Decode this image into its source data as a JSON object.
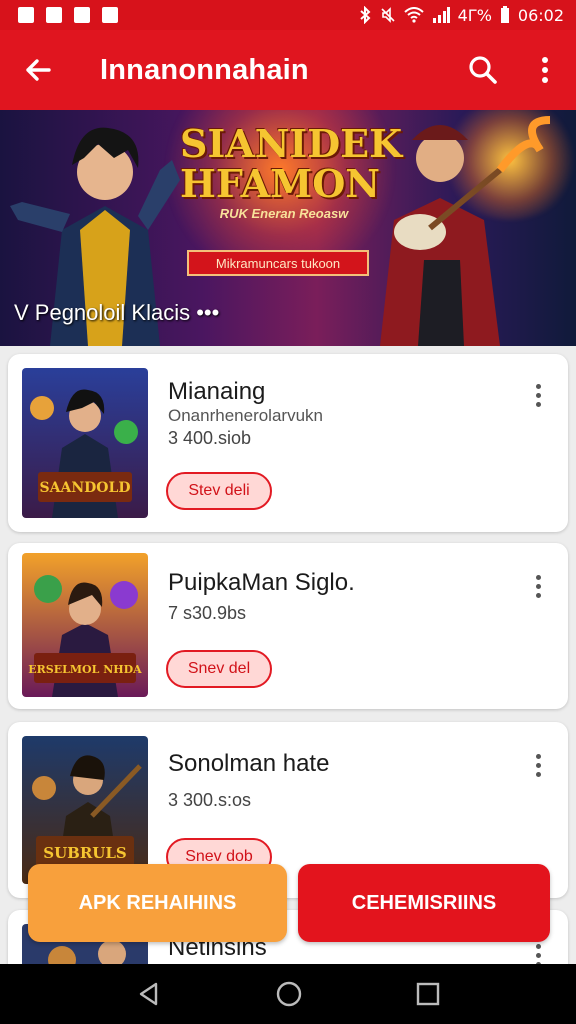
{
  "status_bar": {
    "battery": "4Γ%",
    "time": "06:02"
  },
  "app_bar": {
    "title": "Innanonnahain",
    "back_icon": "arrow-left-icon",
    "search_icon": "search-icon",
    "menu_icon": "more-vertical-icon"
  },
  "banner": {
    "title_line1": "SIANIDEK",
    "title_line2": "HFAMON",
    "subtitle": "RUK Eneran Reoasw",
    "tag": "Mikramuncars tukoon",
    "caption": "V Pegnoloil Klacis •••"
  },
  "items": [
    {
      "name": "Mianaing",
      "desc": "Onanrhenerolarvukn",
      "size": "3 400.siob",
      "button": "Stev deli",
      "thumb_label": "SAANDOLD"
    },
    {
      "name": "PuipkaMan Siglo.",
      "desc": "",
      "size": "7 s30.9bs",
      "button": "Snev del",
      "thumb_label": "ERSELMOL NHDA"
    },
    {
      "name": "Sonolman hate",
      "desc": "",
      "size": "3 300.s:os",
      "button": "Snev dob",
      "thumb_label": "SUBRULS"
    },
    {
      "name": "Netinsins",
      "desc": "",
      "size": "",
      "button": "",
      "thumb_label": ""
    }
  ],
  "actions": {
    "apk": "APK REHAIHINS",
    "cheme": "CEHEMISRIINS"
  },
  "colors": {
    "primary_red": "#e0151f",
    "accent_orange": "#f8a03c",
    "pill_bg": "#ffd8d6"
  }
}
